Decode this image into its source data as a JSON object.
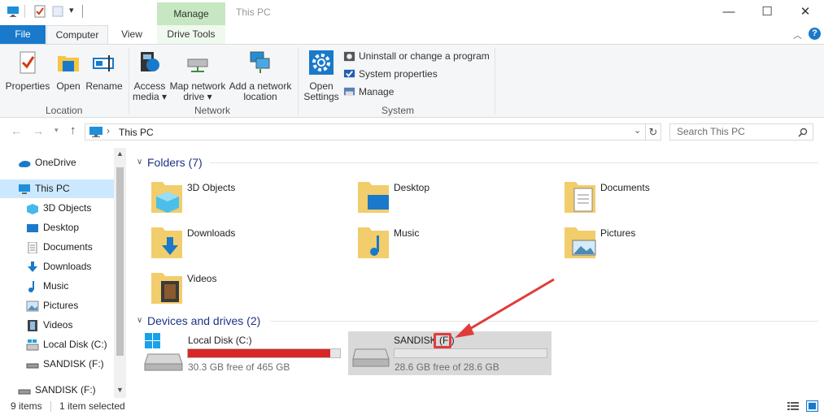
{
  "window": {
    "title": "This PC",
    "context_tab": "Manage",
    "minimize": "—",
    "maximize": "☐",
    "close": "✕"
  },
  "tabs": {
    "file": "File",
    "computer": "Computer",
    "view": "View",
    "drive_tools": "Drive Tools"
  },
  "ribbon": {
    "location": {
      "label": "Location",
      "properties": "Properties",
      "open": "Open",
      "rename": "Rename"
    },
    "network": {
      "label": "Network",
      "access_media_l1": "Access",
      "access_media_l2": "media ▾",
      "map_drive_l1": "Map network",
      "map_drive_l2": "drive ▾",
      "add_location_l1": "Add a network",
      "add_location_l2": "location"
    },
    "system": {
      "label": "System",
      "open_settings_l1": "Open",
      "open_settings_l2": "Settings",
      "uninstall": "Uninstall or change a program",
      "system_properties": "System properties",
      "manage": "Manage"
    }
  },
  "address": {
    "path": "This PC",
    "search_placeholder": "Search This PC"
  },
  "nav": {
    "items": [
      {
        "label": "OneDrive"
      },
      {
        "label": "This PC"
      },
      {
        "label": "3D Objects"
      },
      {
        "label": "Desktop"
      },
      {
        "label": "Documents"
      },
      {
        "label": "Downloads"
      },
      {
        "label": "Music"
      },
      {
        "label": "Pictures"
      },
      {
        "label": "Videos"
      },
      {
        "label": "Local Disk (C:)"
      },
      {
        "label": "SANDISK (F:)"
      },
      {
        "label": "SANDISK (F:)"
      }
    ]
  },
  "folders": {
    "heading": "Folders (7)",
    "items": [
      {
        "label": "3D Objects"
      },
      {
        "label": "Desktop"
      },
      {
        "label": "Documents"
      },
      {
        "label": "Downloads"
      },
      {
        "label": "Music"
      },
      {
        "label": "Pictures"
      },
      {
        "label": "Videos"
      }
    ]
  },
  "drives": {
    "heading": "Devices and drives (2)",
    "items": [
      {
        "name": "Local Disk (C:)",
        "free": "30.3 GB free of 465 GB",
        "used_fraction": 0.935,
        "bar_color": "#da2626"
      },
      {
        "name": "SANDISK (F:)",
        "free": "28.6 GB free of 28.6 GB",
        "used_fraction": 0.0,
        "bar_color": "#26a0da"
      }
    ]
  },
  "status": {
    "count": "9 items",
    "selected": "1 item selected"
  },
  "colors": {
    "accent": "#1979ca",
    "selection": "#cce8ff",
    "selected_drive_bg": "#d9d9d9",
    "annotation": "#e03c3c"
  }
}
